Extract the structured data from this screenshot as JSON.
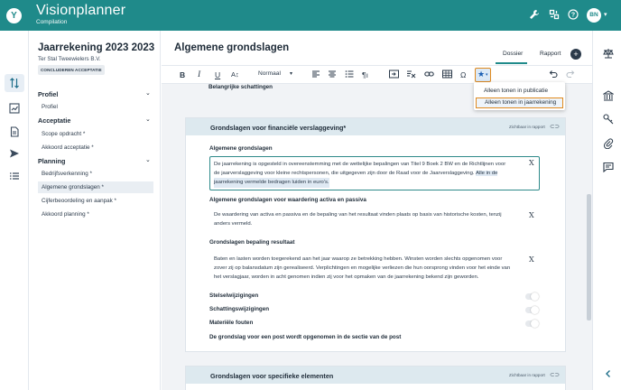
{
  "app": {
    "title": "Visionplanner",
    "subtitle": "Compilation",
    "logo_letter": "Y",
    "user_initials": "BN",
    "brand_color": "#1f8a8a"
  },
  "topbar": {
    "icons": [
      "wrench-icon",
      "bracket-icon",
      "help-icon"
    ]
  },
  "left_rail": {
    "icons": [
      "sort-icon",
      "chart-icon",
      "document-icon",
      "send-icon",
      "list-icon"
    ]
  },
  "sidebar": {
    "doc_title": "Jaarrekening 2023 2023",
    "doc_subtitle": "Ter Stal Tweewielers B.V.",
    "accept_button": "CONCLUDEREN ACCEPTATIE",
    "sections": [
      {
        "label": "Profiel",
        "items": [
          "Profiel"
        ]
      },
      {
        "label": "Acceptatie",
        "items": [
          "Scope opdracht *",
          "Akkoord acceptatie *"
        ]
      },
      {
        "label": "Planning",
        "items": [
          "Bedrijfsverkenning *",
          "Algemene grondslagen *",
          "Cijferbeoordeling en aanpak *",
          "Akkoord planning *"
        ]
      }
    ],
    "selected_item": "Algemene grondslagen *"
  },
  "main": {
    "title": "Algemene grondslagen",
    "tabs": [
      "Dossier",
      "Rapport"
    ],
    "active_tab": "Dossier",
    "toolbar": {
      "bold": "B",
      "italic": "I",
      "underline": "U",
      "font_size": "A↕",
      "style_select": "Normaal",
      "omega": "Ω"
    }
  },
  "content": {
    "prev_label": "Belangrijke schattingen",
    "card1": {
      "title": "Grondslagen voor financiële verslaggeving*",
      "visibility": "Zichtbaar in rapport",
      "sections": [
        {
          "label": "Algemene grondslagen",
          "lines": [
            "De jaarrekening is opgesteld in overeenstemming met de wettelijke bepalingen van Titel 9 Boek 2 BW en de Richtlijnen voor",
            "de jaarverslaggeving voor kleine rechtspersonen, die uitgegeven zijn door de Raad voor de Jaarverslaggeving."
          ],
          "highlight_1": "Alle in de",
          "highlight_2": "jaarrekening vermelde bedragen luiden in euro's."
        },
        {
          "label": "Algemene grondslagen voor waardering activa en passiva",
          "lines": [
            "De waardering van activa en passiva en de bepaling van het resultaat vinden plaats op basis van historische kosten, tenzij",
            "anders vermeld."
          ]
        },
        {
          "label": "Grondslagen bepaling resultaat",
          "lines": [
            "Baten en lasten worden toegerekend aan het jaar waarop ze betrekking hebben. Winsten worden slechts opgenomen voor",
            "zover zij op balansdatum zijn gerealiseerd. Verplichtingen en mogelijke verliezen die hun oorsprong vinden voor het einde van",
            "het verslagjaar, worden in acht genomen indien zij voor het opmaken van de jaarrekening bekend zijn geworden."
          ]
        }
      ],
      "toggles": [
        "Stelselwijzigingen",
        "Schattingswijzigingen",
        "Materiële fouten"
      ],
      "footer": "De grondslag voor een post wordt opgenomen in de sectie van de post"
    },
    "card2": {
      "title": "Grondslagen voor specifieke elementen",
      "visibility": "Zichtbaar in rapport"
    }
  },
  "dropdown": {
    "items": [
      "Alleen tonen in publicatie",
      "Alleen tonen in jaarrekening"
    ],
    "highlighted": "Alleen tonen in jaarrekening"
  },
  "right_rail": {
    "icons": [
      "scale-icon",
      "bank-icon",
      "key-icon",
      "paperclip-icon",
      "comment-icon",
      "chevron-left-icon"
    ]
  }
}
